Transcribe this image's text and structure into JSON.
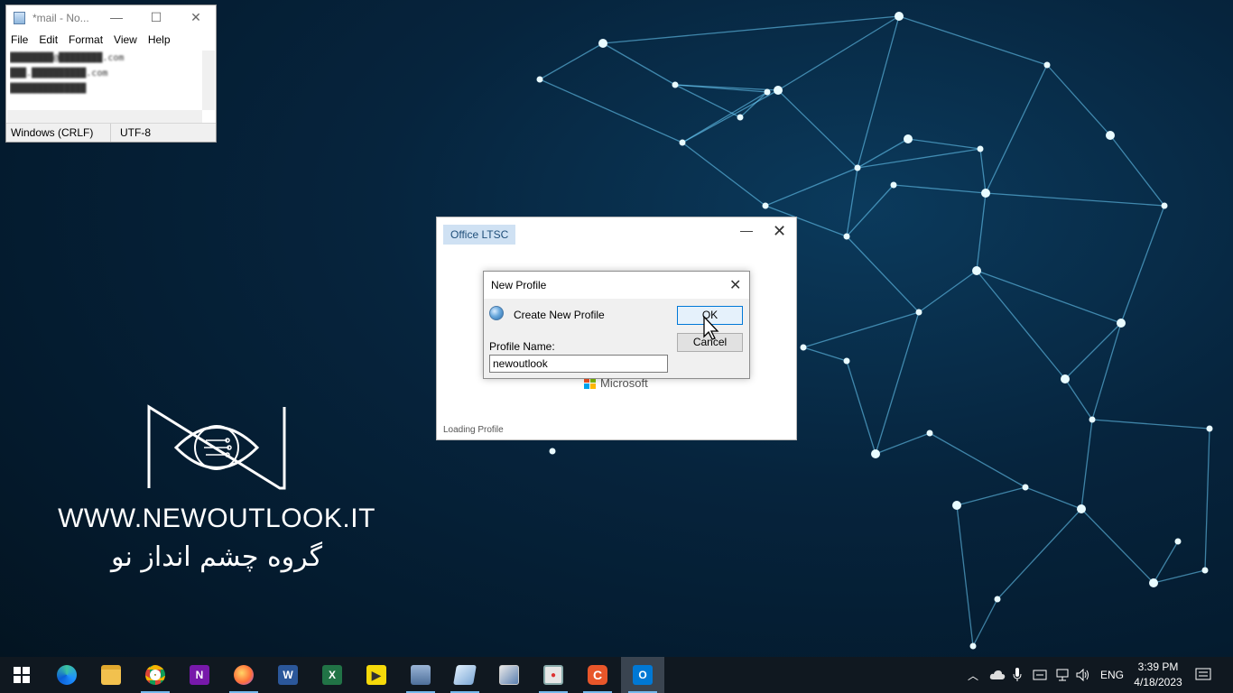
{
  "brand": {
    "url": "WWW.NEWOUTLOOK.IT",
    "tagline_fa": "گروه چشم انداز نو"
  },
  "notepad": {
    "title": "*mail - No...",
    "menu": [
      "File",
      "Edit",
      "Format",
      "View",
      "Help"
    ],
    "lines": [
      "████████@████████.com",
      "███.██████████.com",
      "██████████████"
    ],
    "status_eol": "Windows (CRLF)",
    "status_encoding": "UTF-8"
  },
  "office_window": {
    "title": "Office LTSC",
    "brand": "Microsoft",
    "status": "Loading Profile"
  },
  "new_profile_dialog": {
    "title": "New Profile",
    "heading": "Create New Profile",
    "field_label": "Profile Name:",
    "field_value": "newoutlook",
    "ok_label": "OK",
    "cancel_label": "Cancel"
  },
  "taskbar": {
    "apps": [
      {
        "name": "start",
        "icon": "windows-icon"
      },
      {
        "name": "edge",
        "icon": "edge-icon"
      },
      {
        "name": "file-explorer",
        "icon": "folder-icon"
      },
      {
        "name": "chrome",
        "icon": "chrome-icon"
      },
      {
        "name": "onenote",
        "icon": "onenote-icon",
        "letter": "N"
      },
      {
        "name": "firefox",
        "icon": "firefox-icon"
      },
      {
        "name": "word",
        "icon": "word-icon",
        "letter": "W"
      },
      {
        "name": "excel",
        "icon": "excel-icon",
        "letter": "X"
      },
      {
        "name": "kmplayer",
        "icon": "player-icon"
      },
      {
        "name": "network-app",
        "icon": "network-icon"
      },
      {
        "name": "notepad",
        "icon": "notepad-icon"
      },
      {
        "name": "snipping",
        "icon": "snip-icon"
      },
      {
        "name": "recorder",
        "icon": "recorder-icon"
      },
      {
        "name": "camtasia",
        "icon": "camtasia-icon"
      },
      {
        "name": "outlook",
        "icon": "outlook-icon",
        "letter": "O"
      }
    ],
    "language": "ENG",
    "time": "3:39 PM",
    "date": "4/18/2023"
  }
}
